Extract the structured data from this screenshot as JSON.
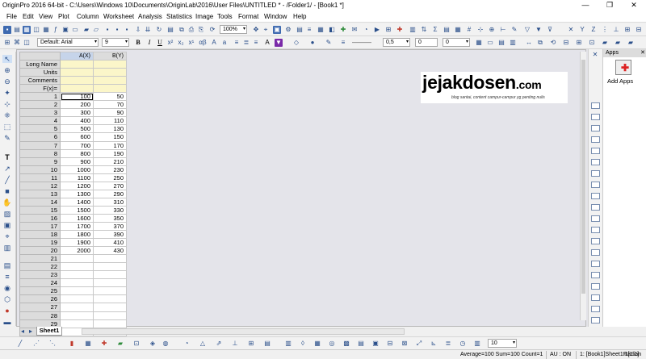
{
  "window": {
    "title": "OriginPro 2016 64-bit - C:\\Users\\Windows 10\\Documents\\OriginLab\\2016\\User Files\\UNTITLED * - /Folder1/ - [Book1 *]",
    "minimize": "—",
    "maximize": "❐",
    "close": "✕"
  },
  "menu": [
    "File",
    "Edit",
    "View",
    "Plot",
    "Column",
    "Worksheet",
    "Analysis",
    "Statistics",
    "Image",
    "Tools",
    "Format",
    "Window",
    "Help"
  ],
  "toolbar": {
    "zoom": "100%",
    "font_name": "Default: Arial",
    "font_size": "9",
    "bold": "B",
    "italic": "I",
    "underline": "U",
    "line_width": "0,5",
    "field_a": "0",
    "field_b": "0"
  },
  "worksheet": {
    "columns": [
      "A(X)",
      "B(Y)"
    ],
    "meta_rows": [
      "Long Name",
      "Units",
      "Comments",
      "F(x)="
    ],
    "rows": [
      {
        "n": "1",
        "a": "100",
        "b": "50"
      },
      {
        "n": "2",
        "a": "200",
        "b": "70"
      },
      {
        "n": "3",
        "a": "300",
        "b": "90"
      },
      {
        "n": "4",
        "a": "400",
        "b": "110"
      },
      {
        "n": "5",
        "a": "500",
        "b": "130"
      },
      {
        "n": "6",
        "a": "600",
        "b": "150"
      },
      {
        "n": "7",
        "a": "700",
        "b": "170"
      },
      {
        "n": "8",
        "a": "800",
        "b": "190"
      },
      {
        "n": "9",
        "a": "900",
        "b": "210"
      },
      {
        "n": "10",
        "a": "1000",
        "b": "230"
      },
      {
        "n": "11",
        "a": "1100",
        "b": "250"
      },
      {
        "n": "12",
        "a": "1200",
        "b": "270"
      },
      {
        "n": "13",
        "a": "1300",
        "b": "290"
      },
      {
        "n": "14",
        "a": "1400",
        "b": "310"
      },
      {
        "n": "15",
        "a": "1500",
        "b": "330"
      },
      {
        "n": "16",
        "a": "1600",
        "b": "350"
      },
      {
        "n": "17",
        "a": "1700",
        "b": "370"
      },
      {
        "n": "18",
        "a": "1800",
        "b": "390"
      },
      {
        "n": "19",
        "a": "1900",
        "b": "410"
      },
      {
        "n": "20",
        "a": "2000",
        "b": "430"
      },
      {
        "n": "21",
        "a": "",
        "b": ""
      },
      {
        "n": "22",
        "a": "",
        "b": ""
      },
      {
        "n": "23",
        "a": "",
        "b": ""
      },
      {
        "n": "24",
        "a": "",
        "b": ""
      },
      {
        "n": "25",
        "a": "",
        "b": ""
      },
      {
        "n": "26",
        "a": "",
        "b": ""
      },
      {
        "n": "27",
        "a": "",
        "b": ""
      },
      {
        "n": "28",
        "a": "",
        "b": ""
      },
      {
        "n": "29",
        "a": "",
        "b": ""
      },
      {
        "n": "30",
        "a": "",
        "b": ""
      }
    ],
    "sheet_tab": "Sheet1"
  },
  "logo": {
    "main": "jejakdosen",
    "suffix": ".com",
    "slogan": "blog santai, content campur-campur yg penting nulis"
  },
  "apps_panel": {
    "title": "Apps",
    "close": "✕",
    "add_apps_label": "Add Apps"
  },
  "bottom_toolbar": {
    "size_field": "10"
  },
  "status": {
    "stats": "Average=100 Sum=100 Count=1",
    "au": "AU : ON",
    "location": "1: [Book1]Sheet1!1[1:1]",
    "units": "Radian"
  }
}
